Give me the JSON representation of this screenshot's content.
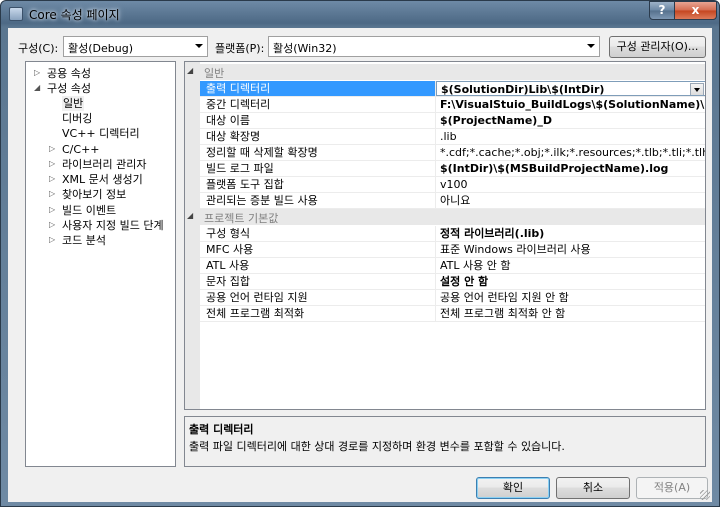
{
  "window": {
    "title": "Core 속성 페이지",
    "help_label": "?",
    "close_label": "x"
  },
  "toolbar": {
    "config_label": "구성(C):",
    "config_value": "활성(Debug)",
    "platform_label": "플랫폼(P):",
    "platform_value": "활성(Win32)",
    "config_manager_label": "구성 관리자(O)..."
  },
  "tree": {
    "items": [
      {
        "label": "공용 속성",
        "expander": "▷"
      },
      {
        "label": "구성 속성",
        "expander": "◢"
      },
      {
        "label": "일반",
        "expander": ""
      },
      {
        "label": "디버깅",
        "expander": ""
      },
      {
        "label": "VC++ 디렉터리",
        "expander": ""
      },
      {
        "label": "C/C++",
        "expander": "▷"
      },
      {
        "label": "라이브러리 관리자",
        "expander": "▷"
      },
      {
        "label": "XML 문서 생성기",
        "expander": "▷"
      },
      {
        "label": "찾아보기 정보",
        "expander": "▷"
      },
      {
        "label": "빌드 이벤트",
        "expander": "▷"
      },
      {
        "label": "사용자 지정 빌드 단계",
        "expander": "▷"
      },
      {
        "label": "코드 분석",
        "expander": "▷"
      }
    ]
  },
  "grid": {
    "categories": [
      {
        "name": "일반",
        "expander": "◢",
        "rows": [
          {
            "name": "출력 디렉터리",
            "value": "$(SolutionDir)Lib\\$(IntDir)"
          },
          {
            "name": "중간 디렉터리",
            "value": "F:\\VisualStuio_BuildLogs\\$(SolutionName)\\$(ProjectN"
          },
          {
            "name": "대상 이름",
            "value": "$(ProjectName)_D"
          },
          {
            "name": "대상 확장명",
            "value": ".lib"
          },
          {
            "name": "정리할 때 삭제할 확장명",
            "value": "*.cdf;*.cache;*.obj;*.ilk;*.resources;*.tlb;*.tli;*.tlh;*.tmp;*.rsp;"
          },
          {
            "name": "빌드 로그 파일",
            "value": "$(IntDir)\\$(MSBuildProjectName).log"
          },
          {
            "name": "플랫폼 도구 집합",
            "value": "v100"
          },
          {
            "name": "관리되는 증분 빌드 사용",
            "value": "아니요"
          }
        ]
      },
      {
        "name": "프로젝트 기본값",
        "expander": "◢",
        "rows": [
          {
            "name": "구성 형식",
            "value": "정적 라이브러리(.lib)"
          },
          {
            "name": "MFC 사용",
            "value": "표준 Windows 라이브러리 사용"
          },
          {
            "name": "ATL 사용",
            "value": "ATL 사용 안 함"
          },
          {
            "name": "문자 집합",
            "value": "설정 안 함"
          },
          {
            "name": "공용 언어 런타임 지원",
            "value": "공용 언어 런타임 지원 안 함"
          },
          {
            "name": "전체 프로그램 최적화",
            "value": "전체 프로그램 최적화 안 함"
          }
        ]
      }
    ]
  },
  "description": {
    "title": "출력 디렉터리",
    "text": "출력 파일 디렉터리에 대한 상대 경로를 지정하며 환경 변수를 포함할 수 있습니다."
  },
  "buttons": {
    "ok": "확인",
    "cancel": "취소",
    "apply": "적용(A)"
  }
}
